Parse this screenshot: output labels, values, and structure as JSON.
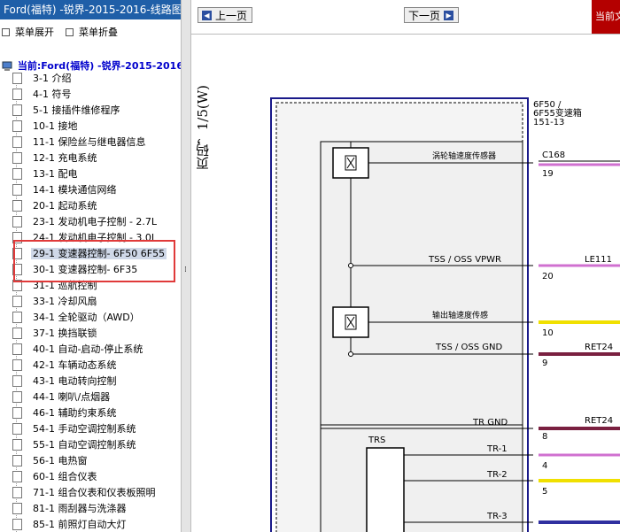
{
  "left_panel": {
    "title": "Ford(福特) -锐界-2015-2016-线路图",
    "expand_label": "菜单展开",
    "collapse_label": "菜单折叠",
    "root_label": "当前:Ford(福特) -锐界-2015-2016",
    "items": [
      "3-1 介绍",
      "4-1 符号",
      "5-1 接插件维修程序",
      "10-1 接地",
      "11-1 保险丝与继电器信息",
      "12-1 充电系统",
      "13-1 配电",
      "14-1 模块通信网络",
      "20-1 起动系统",
      "23-1 发动机电子控制 - 2.7L",
      "24-1 发动机电子控制 - 3.0L",
      "29-1 变速器控制- 6F50 6F55",
      "30-1 变速器控制- 6F35",
      "31-1 巡航控制",
      "33-1 冷却风扇",
      "34-1 全轮驱动（AWD）",
      "37-1 换挡联锁",
      "40-1 自动-启动-停止系统",
      "42-1 车辆动态系统",
      "43-1 电动转向控制",
      "44-1 喇叭/点烟器",
      "46-1 辅助约束系统",
      "54-1 手动空调控制系统",
      "55-1 自动空调控制系统",
      "56-1 电热窗",
      "60-1 组合仪表",
      "71-1 组合仪表和仪表板照明",
      "81-1 雨刮器与洗涤器",
      "85-1 前照灯自动大灯"
    ],
    "selected_index": 11
  },
  "viewer": {
    "prev_label": "上一页",
    "next_label": "下一页",
    "red_label": "当前文",
    "page_label": "页码，1/5(W)"
  },
  "diagram": {
    "module_label_1": "6F50 /",
    "module_label_2": "6F55变速箱",
    "module_label_3": "151-13",
    "sensor1_label": "涡轮轴速度传感器",
    "sensor2_label": "输出轴速度传感",
    "connector": "C168",
    "pins": [
      {
        "name": "TSS / OSS VPWR",
        "pin": "20",
        "wire": "LE111"
      },
      {
        "name": "",
        "pin": "19",
        "wire": ""
      },
      {
        "name": "",
        "pin": "10",
        "wire": ""
      },
      {
        "name": "TSS / OSS GND",
        "pin": "9",
        "wire": "RET24"
      },
      {
        "name": "TR GND",
        "pin": "8",
        "wire": "RET24"
      },
      {
        "name": "TR-1",
        "pin": "4",
        "wire": ""
      },
      {
        "name": "TR-2",
        "pin": "5",
        "wire": ""
      },
      {
        "name": "TR-3",
        "pin": "",
        "wire": ""
      }
    ],
    "trs_label": "TRS",
    "colors": {
      "blue_frame": "#1a1a8a",
      "gray_block": "#f0f0f0",
      "wire_pink": "#d070d0",
      "wire_yellow": "#f0e000",
      "wire_brown": "#7a2040",
      "wire_purple": "#3030a0"
    }
  }
}
